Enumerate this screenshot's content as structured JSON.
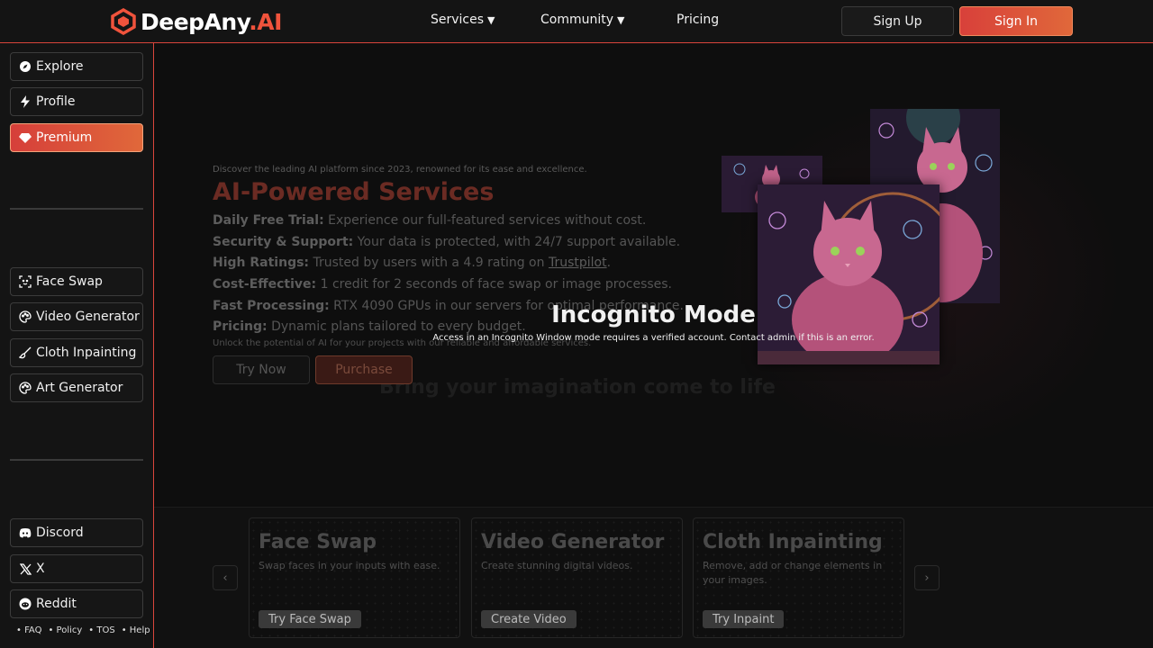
{
  "header": {
    "logo_text": "DeepAny",
    "logo_suffix": ".AI",
    "nav": [
      {
        "label": "Services",
        "caret": "▼"
      },
      {
        "label": "Community",
        "caret": "▼"
      },
      {
        "label": "Pricing"
      }
    ],
    "signup_label": "Sign Up",
    "signin_label": "Sign In"
  },
  "sidebar": {
    "top_items": [
      {
        "label": "Explore",
        "icon": "compass-icon"
      },
      {
        "label": "Profile",
        "icon": "bolt-icon"
      },
      {
        "label": "Premium",
        "icon": "diamond-icon"
      }
    ],
    "tool_items": [
      {
        "label": "Face Swap",
        "icon": "face-scan-icon"
      },
      {
        "label": "Video Generator",
        "icon": "palette-icon"
      },
      {
        "label": "Cloth Inpainting",
        "icon": "brush-icon"
      },
      {
        "label": "Art Generator",
        "icon": "palette-icon"
      }
    ],
    "social_items": [
      {
        "label": "Discord",
        "icon": "discord-icon"
      },
      {
        "label": "X",
        "icon": "x-logo-icon"
      },
      {
        "label": "Reddit",
        "icon": "reddit-icon"
      }
    ],
    "footer_links": [
      "• FAQ",
      "• Policy",
      "• TOS",
      "• Help"
    ]
  },
  "hero": {
    "tagline": "Discover the leading AI platform since 2023, renowned for its ease and excellence.",
    "title": "AI-Powered Services",
    "features": [
      {
        "label": "Daily Free Trial:",
        "text": " Experience our full-featured services without cost."
      },
      {
        "label": "Security & Support:",
        "text": " Your data is protected, with 24/7 support available."
      },
      {
        "label": "High Ratings:",
        "text": " Trusted by users with a 4.9 rating on ",
        "link": "Trustpilot",
        "after": "."
      },
      {
        "label": "Cost-Effective:",
        "text": " 1 credit for 2 seconds of face swap or image processes."
      },
      {
        "label": "Fast Processing:",
        "text": " RTX 4090 GPUs in our servers for optimal performance."
      },
      {
        "label": "Pricing:",
        "text": " Dynamic plans tailored to every budget."
      }
    ],
    "subtext": "Unlock the potential of AI for your projects with our reliable and affordable services.",
    "background_text": "Bring your imagination come to life",
    "try_label": "Try Now",
    "purchase_label": "Purchase"
  },
  "incognito": {
    "title": "Incognito Mode",
    "message": "Access in an Incognito Window mode requires a verified account. Contact admin if this is an error."
  },
  "cards": [
    {
      "title": "Face Swap",
      "desc": "Swap faces in your inputs with ease.",
      "button": "Try Face Swap"
    },
    {
      "title": "Video Generator",
      "desc": "Create stunning digital videos.",
      "button": "Create Video"
    },
    {
      "title": "Cloth Inpainting",
      "desc": "Remove, add or change elements in your images.",
      "button": "Try Inpaint"
    }
  ],
  "carousel": {
    "prev": "‹",
    "next": "›"
  },
  "colors": {
    "accent": "#d9453b",
    "accent_light": "#f0533c"
  }
}
